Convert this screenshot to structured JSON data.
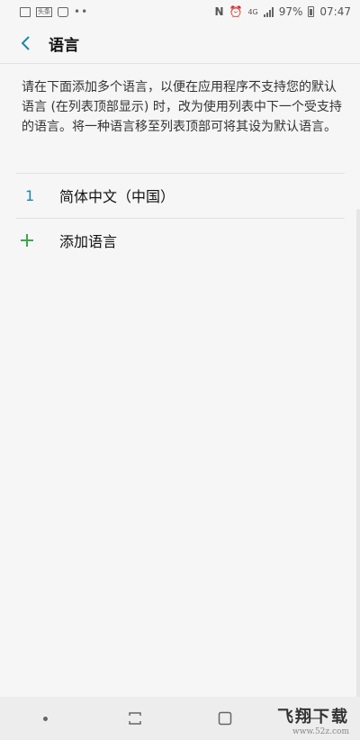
{
  "status_bar": {
    "left_badge": "头条",
    "battery": "97%",
    "time": "07:47",
    "network": "4G"
  },
  "app_bar": {
    "title": "语言",
    "back_icon": "chevron-left-icon"
  },
  "description": "请在下面添加多个语言，以便在应用程序不支持您的默认语言 (在列表顶部显示) 时，改为使用列表中下一个受支持的语言。将一种语言移至列表顶部可将其设为默认语言。",
  "languages": [
    {
      "number": "1",
      "label": "简体中文（中国）"
    }
  ],
  "add_language": {
    "label": "添加语言",
    "icon": "plus-icon"
  },
  "watermark": {
    "main": "飞翔下载",
    "sub": "www.52z.com"
  },
  "colors": {
    "accent_blue": "#1c87a8",
    "plus_green": "#3aa84a",
    "background": "#f6f6f6"
  }
}
